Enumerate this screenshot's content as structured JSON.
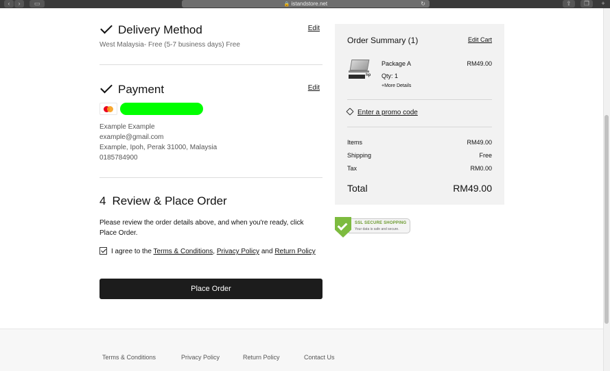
{
  "browser": {
    "url": "istandstore.net"
  },
  "delivery": {
    "title": "Delivery Method",
    "edit_label": "Edit",
    "detail": "West Malaysia- Free (5-7 business days) Free"
  },
  "payment": {
    "title": "Payment",
    "edit_label": "Edit",
    "card_icon": "mastercard-icon",
    "address_lines": [
      "Example Example",
      "example@gmail.com",
      "Example, Ipoh, Perak 31000, Malaysia",
      "0185784900"
    ]
  },
  "review": {
    "step_number": "4",
    "title": "Review & Place Order",
    "instructions": "Please review the order details above, and when you're ready, click Place Order.",
    "agree_prefix": "I agree to the",
    "terms_link": "Terms & Conditions",
    "privacy_link": "Privacy Policy",
    "and_word": "and",
    "return_link": "Return Policy",
    "agree_checked": true,
    "place_order_label": "Place Order"
  },
  "summary": {
    "title": "Order Summary (1)",
    "edit_cart_label": "Edit Cart",
    "item": {
      "name": "Package A",
      "qty": "Qty: 1",
      "more_details": "+More Details",
      "price": "RM49.00"
    },
    "promo_label": "Enter a promo code",
    "lines": [
      {
        "label": "Items",
        "value": "RM49.00"
      },
      {
        "label": "Shipping",
        "value": "Free"
      },
      {
        "label": "Tax",
        "value": "RM0.00"
      }
    ],
    "total_label": "Total",
    "total_value": "RM49.00"
  },
  "ssl_badge": {
    "line1": "SSL SECURE SHOPPING",
    "line2": "Your data is safe and secure."
  },
  "footer": {
    "links": [
      "Terms & Conditions",
      "Privacy Policy",
      "Return Policy",
      "Contact Us"
    ]
  },
  "colors": {
    "summary_bg": "#f2f2f2",
    "button_bg": "#1c1c1c",
    "redaction": "#00ff00"
  }
}
